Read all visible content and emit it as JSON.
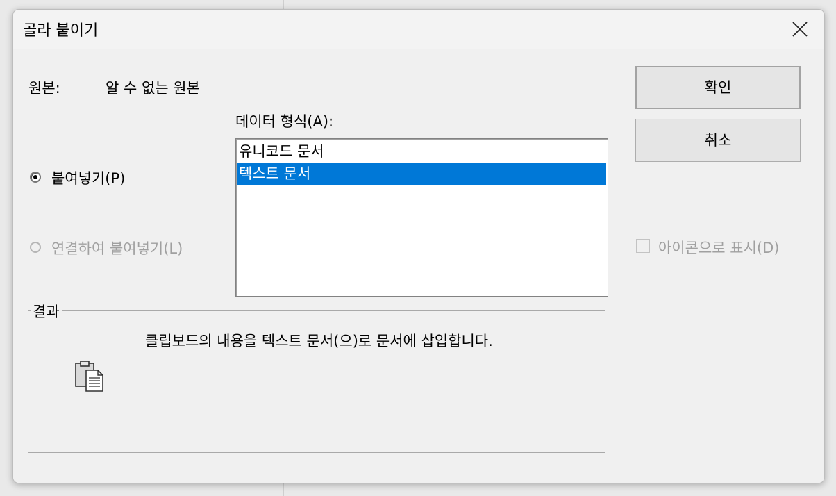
{
  "dialog": {
    "title": "골라 붙이기",
    "close_icon": "close-icon",
    "source_label": "원본:",
    "source_value": "알 수 없는 원본",
    "format_label": "데이터 형식(A):",
    "radio_paste": "붙여넣기(P)",
    "radio_paste_link": "연결하여 붙여넣기(L)",
    "formats": [
      "유니코드 문서",
      "텍스트 문서"
    ],
    "selected_format_index": 1,
    "ok_label": "확인",
    "cancel_label": "취소",
    "display_icon_label": "아이콘으로 표시(D)",
    "display_icon_checked": false,
    "result_label": "결과",
    "result_text": "클립보드의 내용을 텍스트 문서(으)로 문서에 삽입합니다.",
    "result_icon": "clipboard-document-icon",
    "accent_color": "#0078d7"
  }
}
